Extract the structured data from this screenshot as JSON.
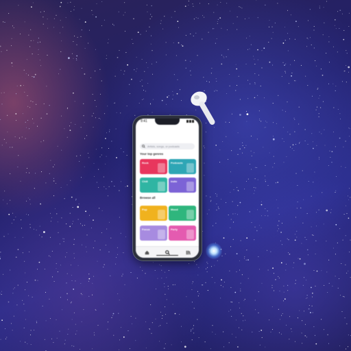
{
  "colors": {
    "space_deep": "#1d1b55",
    "space_blue": "#2a2c8a",
    "nebula_pink": "#be5a6e",
    "phone_frame": "#2c2f3c",
    "screen_bg": "#ffffff"
  },
  "phone": {
    "status": {
      "time": "9:41"
    },
    "search": {
      "placeholder": "Artists, songs, or podcasts",
      "icon": "search-icon"
    },
    "sections": [
      {
        "title": "Your top genres",
        "tiles": [
          {
            "label": "Rock",
            "color": "#e8365d"
          },
          {
            "label": "Podcasts",
            "color": "#2ea6b5"
          },
          {
            "label": "Chill",
            "color": "#2fb5a3"
          },
          {
            "label": "Indie",
            "color": "#7c63d6"
          }
        ]
      },
      {
        "title": "Browse all",
        "tiles": [
          {
            "label": "Pop",
            "color": "#f0b21e"
          },
          {
            "label": "Mood",
            "color": "#2fb67d"
          },
          {
            "label": "Focus",
            "color": "#a78be0"
          },
          {
            "label": "Party",
            "color": "#e45bb0"
          }
        ]
      }
    ],
    "tabs": [
      {
        "icon": "home-icon"
      },
      {
        "icon": "search-icon"
      },
      {
        "icon": "library-icon"
      }
    ]
  }
}
